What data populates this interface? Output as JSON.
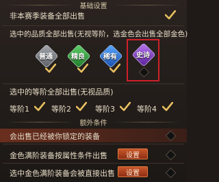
{
  "sections": {
    "basic": "基础设置",
    "extra": "额外条件"
  },
  "rows": {
    "non_season": "非本赛季装备全部出售",
    "quality_prompt": "选中的品质全部出售(无视等阶，选金色会出售全部金色)",
    "tier_prompt": "选中的等阶全部出售(无视品质)",
    "locked": "会出售已经被你锁定的装备",
    "gold_full_attr": "金色满阶装备按属性条件出售",
    "gold_full_direct": "选中金色满阶装备会被直接出售"
  },
  "qualities": [
    {
      "label": "普通",
      "color": "#7a7f86",
      "checked": true
    },
    {
      "label": "精良",
      "color": "#2e9a3a",
      "checked": true
    },
    {
      "label": "稀有",
      "color": "#2a6fd0",
      "checked": true
    },
    {
      "label": "史诗",
      "color": "#8a3fc8",
      "checked": false
    }
  ],
  "tiers": [
    {
      "label": "等阶1",
      "checked": true
    },
    {
      "label": "等阶2",
      "checked": true
    },
    {
      "label": "等阶3",
      "checked": true
    },
    {
      "label": "等阶4",
      "checked": true
    }
  ],
  "buttons": {
    "settings_1": "设置",
    "settings_2": "设置"
  },
  "colors": {
    "check": "#e8c060",
    "highlight": "#d0202a"
  }
}
